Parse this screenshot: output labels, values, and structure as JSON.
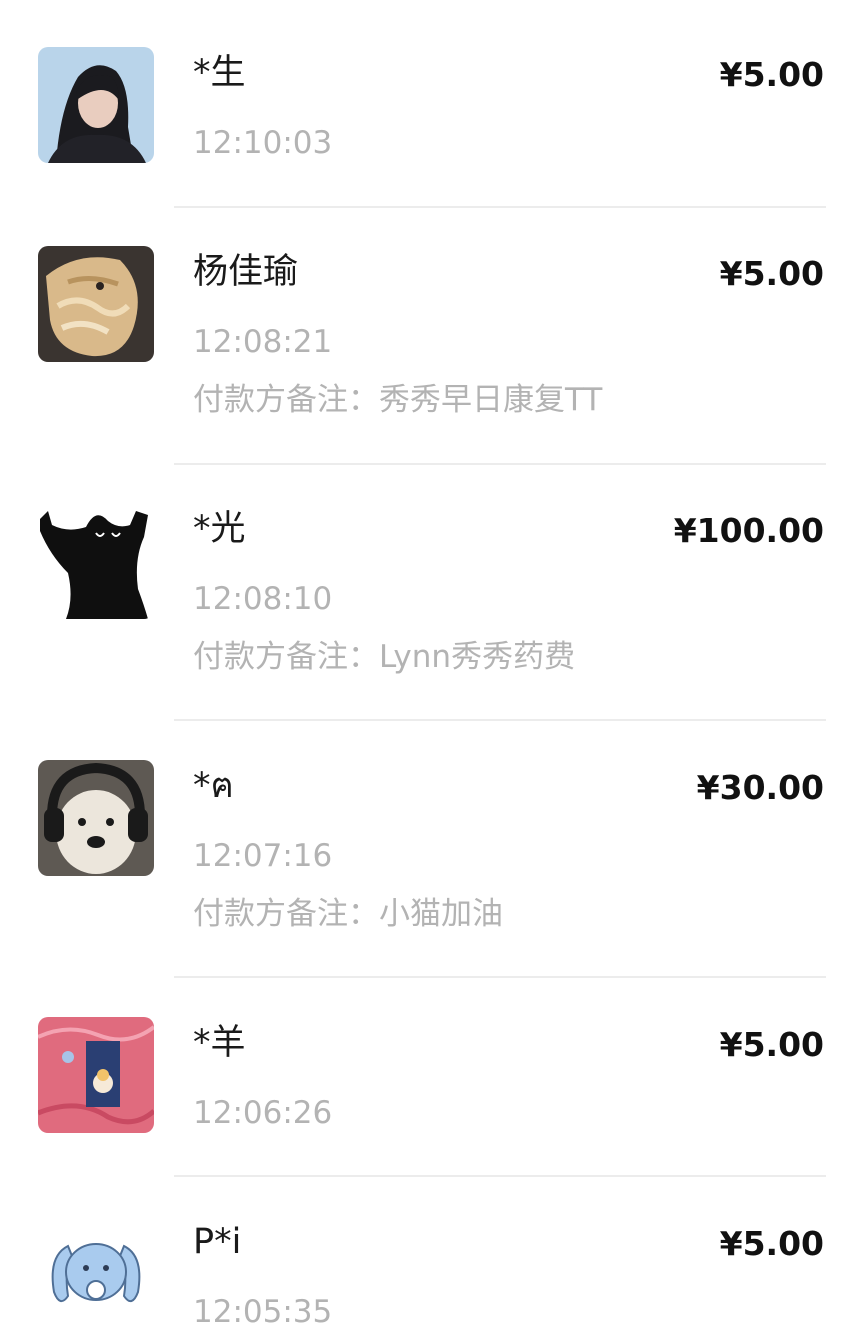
{
  "transactions": [
    {
      "name": "*生",
      "amount": "¥5.00",
      "time": "12:10:03",
      "note": "",
      "avatar_icon": "woman-portrait-avatar"
    },
    {
      "name": "杨佳瑜",
      "amount": "¥5.00",
      "time": "12:08:21",
      "note": "付款方备注：秀秀早日康复TT",
      "avatar_icon": "fluffy-dog-avatar"
    },
    {
      "name": "*光",
      "amount": "¥100.00",
      "time": "12:08:10",
      "note": "付款方备注：Lynn秀秀药费",
      "avatar_icon": "black-cat-avatar"
    },
    {
      "name": "*ฅ",
      "amount": "¥30.00",
      "time": "12:07:16",
      "note": "付款方备注：小猫加油",
      "avatar_icon": "dog-headphones-avatar"
    },
    {
      "name": "*羊",
      "amount": "¥5.00",
      "time": "12:06:26",
      "note": "",
      "avatar_icon": "pink-illustration-avatar"
    },
    {
      "name": "P*i",
      "amount": "¥5.00",
      "time": "12:05:35",
      "note": "",
      "avatar_icon": "blue-bunny-avatar"
    }
  ]
}
